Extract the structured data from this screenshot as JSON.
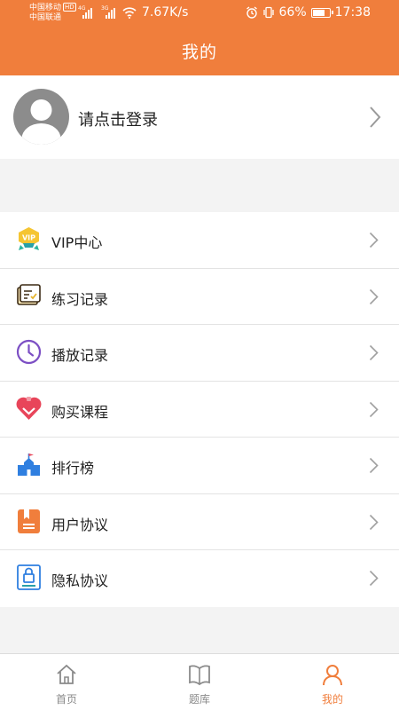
{
  "status_bar": {
    "carrier1": "中国移动",
    "hd_badge": "HD",
    "carrier2": "中国联通",
    "signal1_label": "4G",
    "signal2_label": "3G",
    "net_speed": "7.67K/s",
    "battery": "66%",
    "time": "17:38"
  },
  "header": {
    "title": "我的"
  },
  "profile": {
    "login_prompt": "请点击登录"
  },
  "menu": {
    "items": [
      {
        "label": "VIP中心",
        "icon": "vip-crown-icon"
      },
      {
        "label": "练习记录",
        "icon": "practice-record-icon"
      },
      {
        "label": "播放记录",
        "icon": "clock-icon"
      },
      {
        "label": "购买课程",
        "icon": "heart-gift-icon"
      },
      {
        "label": "排行榜",
        "icon": "ranking-building-icon"
      },
      {
        "label": "用户协议",
        "icon": "document-bookmark-icon"
      },
      {
        "label": "隐私协议",
        "icon": "lock-document-icon"
      }
    ]
  },
  "tabbar": {
    "tabs": [
      {
        "label": "首页",
        "icon": "home-icon",
        "active": false
      },
      {
        "label": "题库",
        "icon": "book-icon",
        "active": false
      },
      {
        "label": "我的",
        "icon": "person-icon",
        "active": true
      }
    ]
  },
  "colors": {
    "accent": "#f07e3c",
    "purple": "#7c4fc4",
    "red": "#e8455a",
    "blue": "#2f7fe0",
    "gold": "#e6b32b",
    "teal": "#29a0a8",
    "gray_text": "#8a8a8a"
  }
}
